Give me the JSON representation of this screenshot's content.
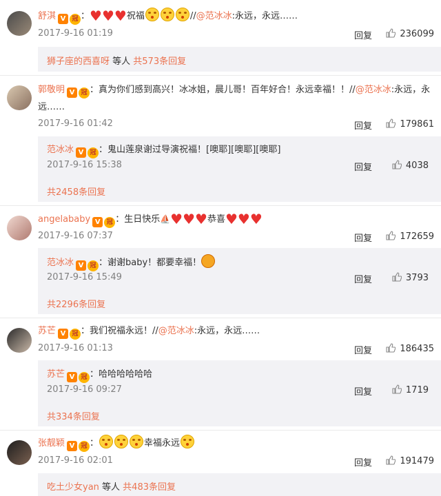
{
  "comments": [
    {
      "user": "舒淇",
      "text_a": "祝福",
      "text_b": "//",
      "at_user": "@范冰冰",
      "text_c": ":永远，永远……",
      "time": "2017-9-16 01:19",
      "reply_label": "回复",
      "likes": "236099",
      "sub_prefix": "狮子座的西喜呀",
      "sub_mid": " 等人 ",
      "sub_link": "共573条回复"
    },
    {
      "user": "郭敬明",
      "text_a": "：真为你们感到高兴！冰冰姐，晨儿哥！百年好合！永远幸福！！//",
      "at_user": "@范冰冰",
      "text_c": ":永远，永远……",
      "time": "2017-9-16 01:42",
      "reply_label": "回复",
      "likes": "179861",
      "reply_user": "范冰冰",
      "reply_text": "：鬼山莲泉谢过导演祝福！[噢耶][噢耶][噢耶]",
      "reply_time": "2017-9-16 15:38",
      "reply_reply_label": "回复",
      "reply_likes": "4038",
      "more_replies": "共2458条回复"
    },
    {
      "user": "angelababy",
      "text_a": "：生日快乐",
      "text_b": "恭喜",
      "time": "2017-9-16 07:37",
      "reply_label": "回复",
      "likes": "172659",
      "reply_user": "范冰冰",
      "reply_text": "：谢谢baby！都要幸福！",
      "reply_time": "2017-9-16 15:49",
      "reply_reply_label": "回复",
      "reply_likes": "3793",
      "more_replies": "共2296条回复"
    },
    {
      "user": "苏芒",
      "text_a": "：我们祝福永远！//",
      "at_user": "@范冰冰",
      "text_c": ":永远，永远……",
      "time": "2017-9-16 01:13",
      "reply_label": "回复",
      "likes": "186435",
      "reply_user": "苏芒",
      "reply_text": "：哈哈哈哈哈哈",
      "reply_time": "2017-9-16 09:27",
      "reply_reply_label": "回复",
      "reply_likes": "1719",
      "more_replies": "共334条回复"
    },
    {
      "user": "张靓颖",
      "text_a": "幸福永远",
      "time": "2017-9-16 02:01",
      "reply_label": "回复",
      "likes": "191479",
      "sub_prefix": "吃土少女yan",
      "sub_mid": " 等人 ",
      "sub_link": "共483条回复"
    }
  ],
  "badges": {
    "verified": "V",
    "crown": "冠"
  },
  "colors": {
    "accent": "#eb7350",
    "reply_bg": "#f2f2f5",
    "heart": "#e8312f",
    "text": "#333333",
    "meta": "#808080"
  },
  "icons": [
    "thumb-up-icon",
    "heart-emoji-icon",
    "smile-emoji-icon",
    "gift-emoji-icon",
    "cake-icon",
    "verified-badge-icon",
    "crown-badge-icon"
  ]
}
